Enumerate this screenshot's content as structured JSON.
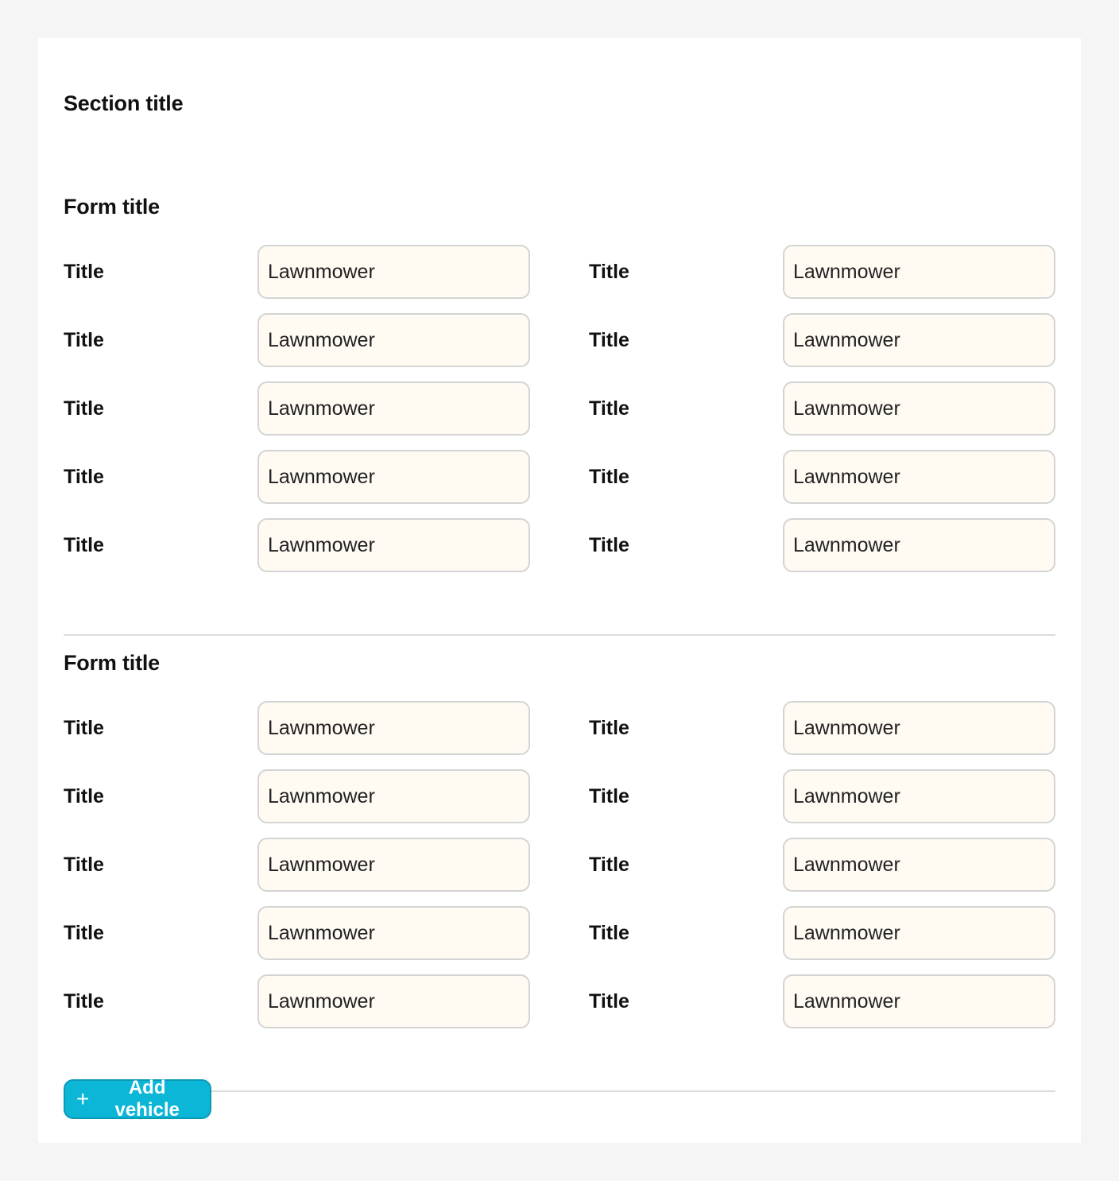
{
  "section": {
    "title": "Section title"
  },
  "forms": [
    {
      "title": "Form title",
      "rows": [
        {
          "left_label": "Title",
          "left_value": "Lawnmower",
          "right_label": "Title",
          "right_value": "Lawnmower"
        },
        {
          "left_label": "Title",
          "left_value": "Lawnmower",
          "right_label": "Title",
          "right_value": "Lawnmower"
        },
        {
          "left_label": "Title",
          "left_value": "Lawnmower",
          "right_label": "Title",
          "right_value": "Lawnmower"
        },
        {
          "left_label": "Title",
          "left_value": "Lawnmower",
          "right_label": "Title",
          "right_value": "Lawnmower"
        },
        {
          "left_label": "Title",
          "left_value": "Lawnmower",
          "right_label": "Title",
          "right_value": "Lawnmower"
        }
      ]
    },
    {
      "title": "Form title",
      "rows": [
        {
          "left_label": "Title",
          "left_value": "Lawnmower",
          "right_label": "Title",
          "right_value": "Lawnmower"
        },
        {
          "left_label": "Title",
          "left_value": "Lawnmower",
          "right_label": "Title",
          "right_value": "Lawnmower"
        },
        {
          "left_label": "Title",
          "left_value": "Lawnmower",
          "right_label": "Title",
          "right_value": "Lawnmower"
        },
        {
          "left_label": "Title",
          "left_value": "Lawnmower",
          "right_label": "Title",
          "right_value": "Lawnmower"
        },
        {
          "left_label": "Title",
          "left_value": "Lawnmower",
          "right_label": "Title",
          "right_value": "Lawnmower"
        }
      ]
    }
  ],
  "actions": {
    "add_icon": "plus-icon",
    "add_label": "Add vehicle"
  },
  "colors": {
    "page_background": "#f5f5f5",
    "card_background": "#ffffff",
    "input_background": "#fffaf2",
    "input_border": "#d4d4d4",
    "button_background": "#0bb6d6",
    "button_border": "#0a9ab7",
    "button_text": "#ffffff"
  }
}
